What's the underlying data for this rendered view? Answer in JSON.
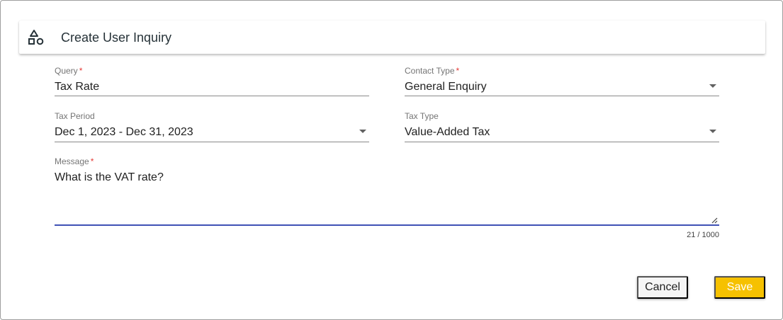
{
  "dialog": {
    "title": "Create User Inquiry",
    "icon": "shapes-icon"
  },
  "form": {
    "query": {
      "label": "Query",
      "required_mark": "*",
      "value": "Tax Rate"
    },
    "contact_type": {
      "label": "Contact Type",
      "required_mark": "*",
      "value": "General Enquiry"
    },
    "tax_period": {
      "label": "Tax Period",
      "value": "Dec 1, 2023 - Dec 31, 2023"
    },
    "tax_type": {
      "label": "Tax Type",
      "value": "Value-Added Tax"
    },
    "message": {
      "label": "Message",
      "required_mark": "*",
      "value": "What is the VAT rate?",
      "counter": "21 / 1000"
    }
  },
  "actions": {
    "cancel_label": "Cancel",
    "save_label": "Save"
  },
  "colors": {
    "accent": "#3f51b5",
    "save_button": "#f6c100",
    "required": "#e53935"
  }
}
